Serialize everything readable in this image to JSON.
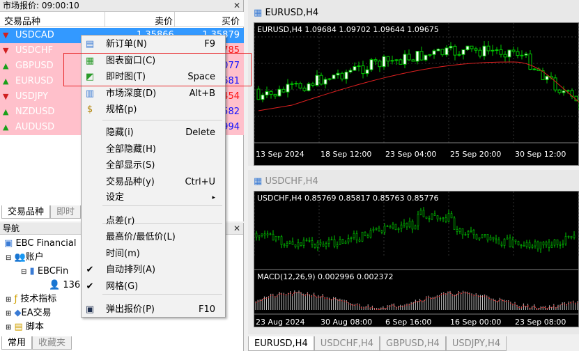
{
  "market_watch": {
    "title": "市场报价: 09:00:10",
    "col_symbol": "交易品种",
    "col_bid": "卖价",
    "col_ask": "买价",
    "rows": [
      {
        "symbol": "USDCAD",
        "bid": "1.35866",
        "ask": "1.35879",
        "dir": "down"
      },
      {
        "symbol": "USDCHF",
        "bid": "",
        "ask": "785",
        "dir": "down"
      },
      {
        "symbol": "GBPUSD",
        "bid": "",
        "ask": "077",
        "dir": "up"
      },
      {
        "symbol": "EURUSD",
        "bid": "",
        "ask": "681",
        "dir": "up"
      },
      {
        "symbol": "USDJPY",
        "bid": "",
        "ask": "454",
        "dir": "down"
      },
      {
        "symbol": "NZDUSD",
        "bid": "",
        "ask": "582",
        "dir": "up"
      },
      {
        "symbol": "AUDUSD",
        "bid": "",
        "ask": "994",
        "dir": "up"
      }
    ],
    "tabs": [
      "交易品种",
      "即时"
    ]
  },
  "navigator": {
    "title": "导航",
    "items": [
      "EBC Financial",
      "账户",
      "EBCFin",
      "136",
      "技术指标",
      "EA交易",
      "脚本"
    ],
    "tabs": [
      "常用",
      "收藏夹"
    ]
  },
  "context_menu": {
    "items": [
      {
        "label": "新订单(N)",
        "key": "F9",
        "icon": "new-order-icon"
      },
      {
        "label": "图表窗口(C)",
        "key": "",
        "icon": "chart-window-icon"
      },
      {
        "label": "即时图(T)",
        "key": "Space",
        "icon": "tick-chart-icon"
      },
      {
        "label": "市场深度(D)",
        "key": "Alt+B",
        "icon": "depth-icon"
      },
      {
        "label": "规格(p)",
        "key": "",
        "icon": "spec-icon"
      },
      {
        "label": "隐藏(i)",
        "key": "Delete",
        "icon": ""
      },
      {
        "label": "全部隐藏(H)",
        "key": "",
        "icon": ""
      },
      {
        "label": "全部显示(S)",
        "key": "",
        "icon": ""
      },
      {
        "label": "交易品种(y)",
        "key": "Ctrl+U",
        "icon": ""
      },
      {
        "label": "设定",
        "key": "▸",
        "icon": ""
      },
      {
        "label": "点差(r)",
        "key": "",
        "icon": ""
      },
      {
        "label": "最高价/最低价(L)",
        "key": "",
        "icon": ""
      },
      {
        "label": "时间(m)",
        "key": "",
        "icon": ""
      },
      {
        "label": "自动排列(A)",
        "key": "",
        "icon": "check"
      },
      {
        "label": "网格(G)",
        "key": "",
        "icon": "check"
      },
      {
        "label": "弹出报价(P)",
        "key": "F10",
        "icon": "popup-icon"
      }
    ]
  },
  "chart1": {
    "window_title": "EURUSD,H4",
    "info": "EURUSD,H4  1.09684 1.09702 1.09644 1.09675",
    "xticks": [
      "13 Sep 2024",
      "18 Sep 12:00",
      "23 Sep 04:00",
      "25 Sep 20:00",
      "30 Sep 12:00"
    ]
  },
  "chart2": {
    "window_title": "USDCHF,H4",
    "info": "USDCHF,H4  0.85769 0.85817 0.85763 0.85776",
    "macd": "MACD(12,26,9) 0.002996 0.002372",
    "xticks": [
      "23 Aug 2024",
      "30 Aug 08:00",
      "6 Sep 16:00",
      "16 Sep 00:00",
      "23 Sep 08:00"
    ]
  },
  "chart_tabs": [
    "EURUSD,H4",
    "USDCHF,H4",
    "GBPUSD,H4",
    "USDJPY,H4"
  ],
  "colors": {
    "up": "#00c800",
    "highlight": "#3399ff",
    "pink": "#ffc0cb",
    "redbox": "#e8282b"
  }
}
